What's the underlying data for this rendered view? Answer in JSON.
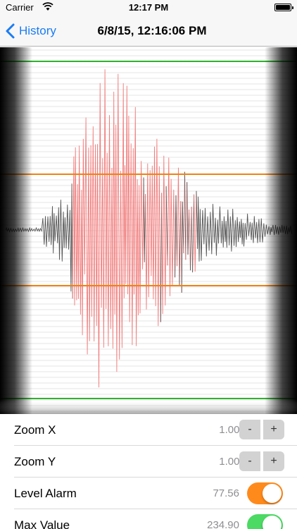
{
  "status_bar": {
    "carrier": "Carrier",
    "time": "12:17 PM",
    "wifi_icon": "wifi-icon",
    "battery_icon": "battery-icon"
  },
  "nav": {
    "back_label": "History",
    "title": "6/8/15, 12:16:06 PM"
  },
  "seismograph": {
    "trace_color_normal": "#555555",
    "trace_color_alarm": "#f27a7a",
    "max_line_color": "#2db22d",
    "alarm_line_color": "#f0820f"
  },
  "settings": {
    "zoom_x": {
      "label": "Zoom X",
      "value": "1.00x",
      "minus": "-",
      "plus": "+"
    },
    "zoom_y": {
      "label": "Zoom Y",
      "value": "1.00x",
      "minus": "-",
      "plus": "+"
    },
    "level_alarm": {
      "label": "Level Alarm",
      "value": "77.56",
      "on": true,
      "color": "#ff8a1c"
    },
    "max_value": {
      "label": "Max Value",
      "value": "234.90",
      "on": true,
      "color": "#4cd964"
    }
  }
}
